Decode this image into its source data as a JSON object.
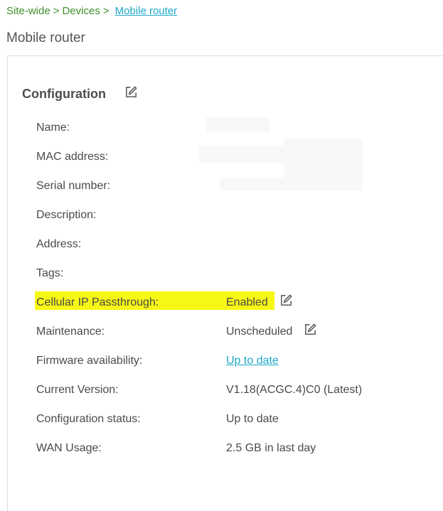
{
  "breadcrumb": {
    "items": [
      "Site-wide",
      "Devices"
    ],
    "separator": ">",
    "current": "Mobile router"
  },
  "page": {
    "title": "Mobile router"
  },
  "configuration": {
    "title": "Configuration",
    "edit_icon": "edit-icon",
    "rows": [
      {
        "label": "Name:",
        "value": ""
      },
      {
        "label": "MAC address:",
        "value": ""
      },
      {
        "label": "Serial number:",
        "value": ""
      },
      {
        "label": "Description:",
        "value": ""
      },
      {
        "label": "Address:",
        "value": ""
      },
      {
        "label": "Tags:",
        "value": ""
      },
      {
        "label": "Cellular IP Passthrough:",
        "value": "Enabled",
        "highlighted": true,
        "editable": true
      },
      {
        "label": "Maintenance:",
        "value": "Unscheduled",
        "editable": true
      },
      {
        "label": "Firmware availability:",
        "value": "Up to date",
        "link": true
      },
      {
        "label": "Current Version:",
        "value": "V1.18(ACGC.4)C0 (Latest)"
      },
      {
        "label": "Configuration status:",
        "value": "Up to date"
      },
      {
        "label": "WAN Usage:",
        "value": "2.5 GB in last day"
      }
    ]
  },
  "colors": {
    "breadcrumb_green": "#3f8f2a",
    "link_blue": "#1fa8c9",
    "highlight_yellow": "#f7f715",
    "text_gray": "#4a4a4a"
  }
}
